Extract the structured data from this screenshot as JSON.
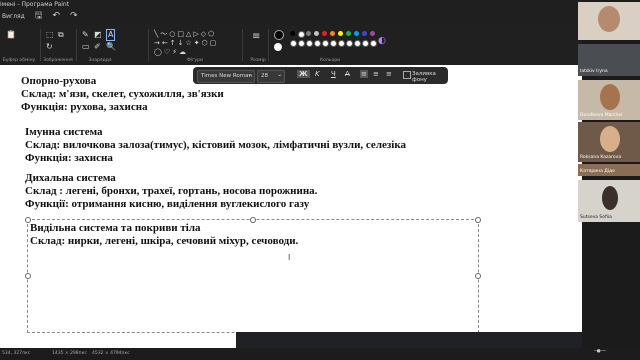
{
  "window": {
    "title": "імені - Програма Paint",
    "menu": [
      "Вигляд"
    ]
  },
  "ribbon": {
    "groups": [
      {
        "label": "Буфер обміну"
      },
      {
        "label": "Зображення"
      },
      {
        "label": "Знаряддя"
      },
      {
        "label": "Фігури"
      },
      {
        "label": "Розмір"
      },
      {
        "label": "Кольори"
      }
    ]
  },
  "colors": {
    "palette_top": [
      "#000000",
      "#ffffff",
      "#7f7f7f",
      "#c3c3c3",
      "#ed1c24",
      "#ff7f27",
      "#fff200",
      "#22b14c",
      "#00a2e8",
      "#3f48cc",
      "#a349a4"
    ],
    "palette_bottom": [
      "#ffffff",
      "#ffffff",
      "#ffffff",
      "#ffffff",
      "#ffffff",
      "#ffffff",
      "#ffffff",
      "#ffffff",
      "#ffffff",
      "#ffffff",
      "#ffffff"
    ]
  },
  "text_toolbar": {
    "font": "Times New Roman",
    "size": "28",
    "fill_label": "Заливка фону"
  },
  "document": {
    "lines": [
      "Опорно-рухова",
      "Склад: м'язи, скелет, сухожилля, зв'язки",
      "Функція: рухова, захисна",
      "Імунна система",
      "Склад: вилочкова залоза(тимус), кістовий мозок, лімфатичні вузли, селезіка",
      "Функція: захисна",
      "Дихальна система",
      "Склад : легені, бронхи, трахеї, гортань, носова порожнина.",
      "Функції: отримання кисню, виділення вуглекислого газу",
      "Видільна система та покриви тіла",
      "Склад: нирки, легені, шкіра, сечовий міхур, сечоводи."
    ]
  },
  "status": {
    "position": "534, 327пкс",
    "selection": "1435 × 298пкс",
    "canvas": "4532 × 4794пкс"
  },
  "participants": [
    {
      "name": ""
    },
    {
      "name": "Iatskiv Iryna"
    },
    {
      "name": "Dorofeeva Marchel"
    },
    {
      "name": "Roksana Kazarova"
    },
    {
      "name": "Катерина Діде"
    },
    {
      "name": "Sutseva Sofiia"
    }
  ]
}
